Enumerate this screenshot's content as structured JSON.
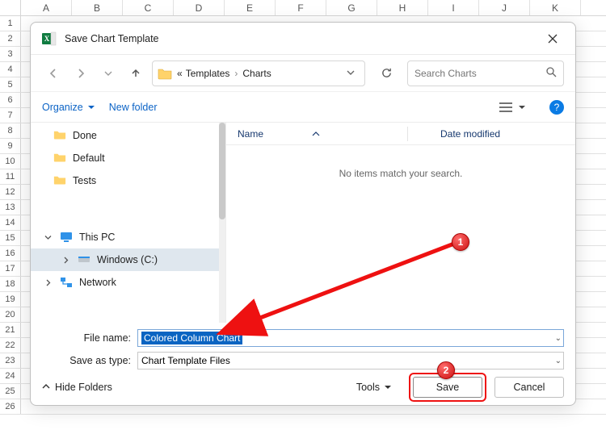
{
  "sheet": {
    "cols": [
      "A",
      "B",
      "C",
      "D",
      "E",
      "F",
      "G",
      "H",
      "I",
      "J",
      "K"
    ],
    "rows": [
      "1",
      "2",
      "3",
      "4",
      "5",
      "6",
      "7",
      "8",
      "9",
      "10",
      "11",
      "12",
      "13",
      "14",
      "15",
      "16",
      "17",
      "18",
      "19",
      "20",
      "21",
      "22",
      "23",
      "24",
      "25",
      "26"
    ]
  },
  "dialog": {
    "title": "Save Chart Template",
    "breadcrumb": {
      "prefix": "«",
      "seg1": "Templates",
      "seg2": "Charts"
    },
    "search": {
      "placeholder": "Search Charts"
    },
    "toolbar": {
      "organize": "Organize",
      "newfolder": "New folder"
    },
    "tree": {
      "items": [
        {
          "label": "Done",
          "icon": "folder"
        },
        {
          "label": "Default",
          "icon": "folder"
        },
        {
          "label": "Tests",
          "icon": "folder"
        }
      ],
      "pc": "This PC",
      "drive": "Windows (C:)",
      "network": "Network"
    },
    "list": {
      "nameHdr": "Name",
      "dateHdr": "Date modified",
      "empty": "No items match your search."
    },
    "fields": {
      "fileNameLabel": "File name:",
      "fileNameValue": "Colored Column Chart",
      "typeLabel": "Save as type:",
      "typeValue": "Chart Template Files"
    },
    "footer": {
      "hide": "Hide Folders",
      "tools": "Tools",
      "save": "Save",
      "cancel": "Cancel"
    }
  },
  "annotations": {
    "m1": "1",
    "m2": "2"
  }
}
